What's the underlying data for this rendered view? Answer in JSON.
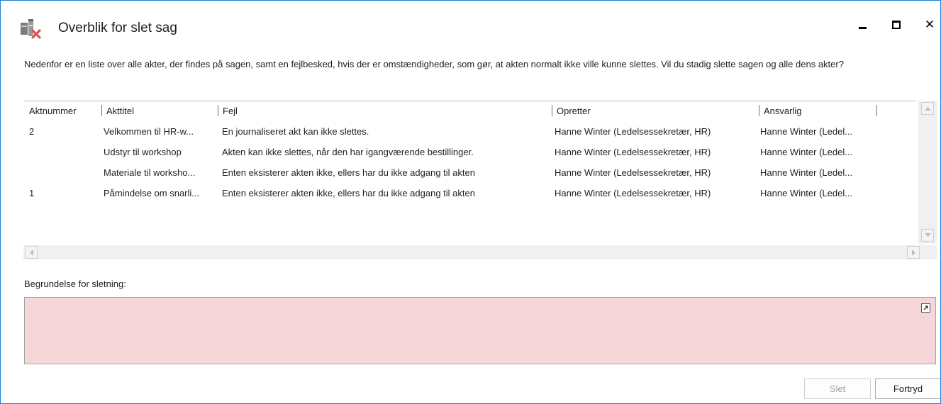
{
  "window": {
    "title": "Overblik for slet sag",
    "controls": {
      "minimize": "minimize",
      "maximize": "maximize",
      "close": "✕"
    }
  },
  "intro_text": "Nedenfor er en liste over alle akter, der findes på sagen, samt en fejlbesked, hvis der er omstændigheder, som gør, at akten normalt ikke ville kunne slettes. Vil du stadig slette sagen og alle dens akter?",
  "table": {
    "columns": [
      "Aktnummer",
      "Akttitel",
      "Fejl",
      "Opretter",
      "Ansvarlig"
    ],
    "rows": [
      {
        "aktnummer": "2",
        "akttitel": "Velkommen til HR-w...",
        "fejl": "En journaliseret akt kan ikke slettes.",
        "opretter": "Hanne Winter (Ledelsessekretær, HR)",
        "ansvarlig": "Hanne Winter (Ledel..."
      },
      {
        "aktnummer": "",
        "akttitel": "Udstyr til workshop",
        "fejl": "Akten kan ikke slettes, når den har igangværende bestillinger.",
        "opretter": "Hanne Winter (Ledelsessekretær, HR)",
        "ansvarlig": "Hanne Winter (Ledel..."
      },
      {
        "aktnummer": "",
        "akttitel": "Materiale til worksho...",
        "fejl": "Enten eksisterer akten ikke, ellers har du ikke adgang til akten",
        "opretter": "Hanne Winter (Ledelsessekretær, HR)",
        "ansvarlig": "Hanne Winter (Ledel..."
      },
      {
        "aktnummer": "1",
        "akttitel": "Påmindelse om snarli...",
        "fejl": "Enten eksisterer akten ikke, ellers har du ikke adgang til akten",
        "opretter": "Hanne Winter (Ledelsessekretær, HR)",
        "ansvarlig": "Hanne Winter (Ledel..."
      }
    ]
  },
  "reason": {
    "label": "Begrundelse for sletning:",
    "value": ""
  },
  "buttons": {
    "delete": "Slet",
    "cancel": "Fortryd"
  },
  "colors": {
    "reason_bg": "#f5d6d9",
    "border_accent": "#1e7fd4",
    "disabled_text": "#a0a0a0"
  }
}
